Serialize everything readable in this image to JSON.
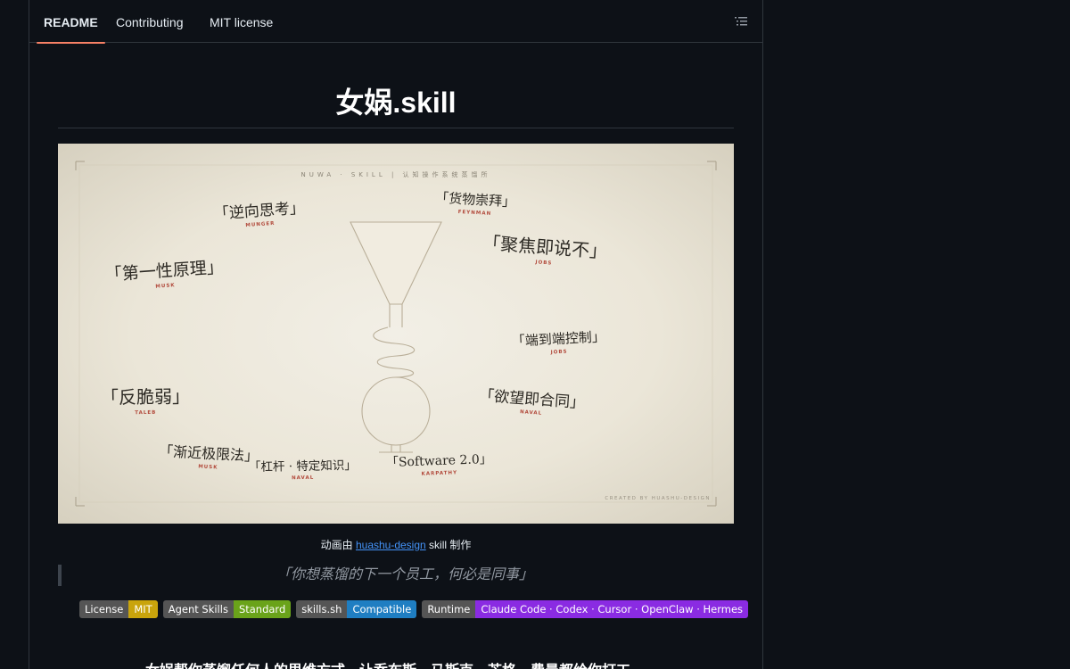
{
  "tabs": {
    "readme": "README",
    "contributing": "Contributing",
    "license": "MIT license"
  },
  "title": "女娲.skill",
  "hero": {
    "header": "NUWA · SKILL  |  认知操作系统蒸馏所",
    "credit": "CREATED BY HUASHU-DESIGN",
    "quotes": [
      {
        "text": "「逆向思考」",
        "who": "MUNGER"
      },
      {
        "text": "「货物崇拜」",
        "who": "FEYNMAN"
      },
      {
        "text": "「聚焦即说不」",
        "who": "JOBS"
      },
      {
        "text": "「第一性原理」",
        "who": "MUSK"
      },
      {
        "text": "「端到端控制」",
        "who": "JOBS"
      },
      {
        "text": "「反脆弱」",
        "who": "TALEB"
      },
      {
        "text": "「欲望即合同」",
        "who": "NAVAL"
      },
      {
        "text": "「渐近极限法」",
        "who": "MUSK"
      },
      {
        "text": "「杠杆 · 特定知识」",
        "who": "NAVAL"
      },
      {
        "text": "「Software 2.0」",
        "who": "KARPATHY"
      }
    ]
  },
  "caption": {
    "prefix": "动画由 ",
    "link": "huashu-design",
    "suffix": " skill 制作"
  },
  "blockquote": "「你想蒸馏的下一个员工，何必是同事」",
  "badges": [
    {
      "label": "License",
      "value": "MIT",
      "color": "#c9a40c"
    },
    {
      "label": "Agent Skills",
      "value": "Standard",
      "color": "#6aa31a"
    },
    {
      "label": "skills.sh",
      "value": "Compatible",
      "color": "#1f7ec2"
    },
    {
      "label": "Runtime",
      "value": "Claude Code · Codex · Cursor · OpenClaw · Hermes",
      "color": "#8a2be2"
    }
  ],
  "bottom_text": "女娲帮你蒸馏任何人的思维方式，让乔布斯、马斯克、芒格、费曼都给你打工"
}
